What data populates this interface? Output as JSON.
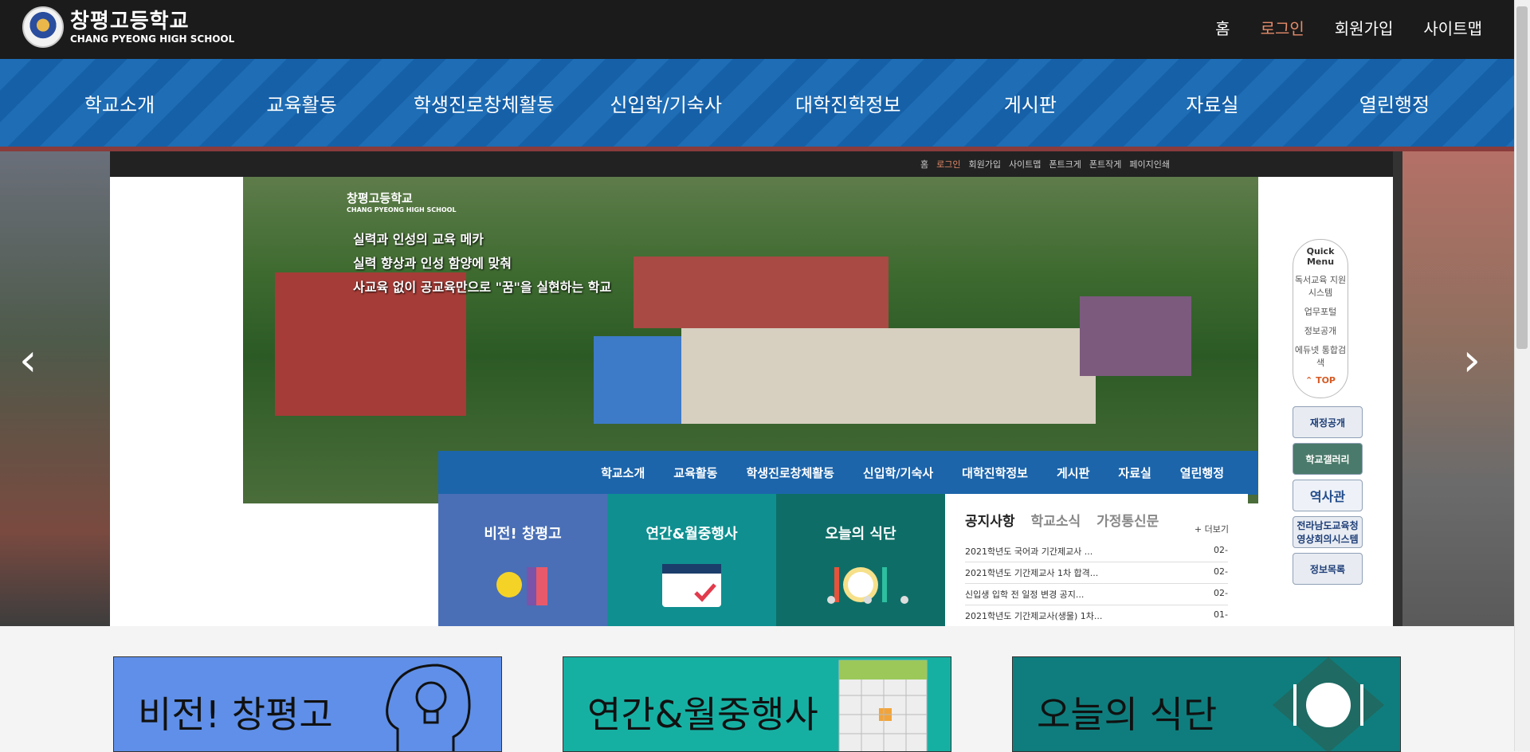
{
  "header": {
    "logo_ko": "창평고등학교",
    "logo_en": "CHANG PYEONG HIGH SCHOOL",
    "util_nav": [
      "홈",
      "로그인",
      "회원가입",
      "사이트맵"
    ]
  },
  "gnb": [
    "학교소개",
    "교육활동",
    "학생진로창체활동",
    "신입학/기숙사",
    "대학진학정보",
    "게시판",
    "자료실",
    "열린행정"
  ],
  "slide": {
    "top_links": [
      "홈",
      "로그인",
      "회원가입",
      "사이트맵",
      "폰트크게",
      "폰트작게",
      "페이지인쇄"
    ],
    "logo_ko": "창평고등학교",
    "logo_en": "CHANG PYEONG HIGH SCHOOL",
    "slogan_1": "실력과 인성의 교육 메카",
    "slogan_2": "실력 향상과 인성 함양에 맞춰",
    "slogan_3": "사교육 없이 공교육만으로 \"꿈\"을 실현하는 학교",
    "inner_nav": [
      "학교소개",
      "교육활동",
      "학생진로창체활동",
      "신입학/기숙사",
      "대학진학정보",
      "게시판",
      "자료실",
      "열린행정"
    ],
    "cards": [
      "비전! 창평고",
      "연간&월중행사",
      "오늘의 식단"
    ],
    "notice": {
      "tabs": [
        "공지사항",
        "학교소식",
        "가정통신문"
      ],
      "more": "+ 더보기",
      "items": [
        {
          "title": "2021학년도 국어과 기간제교사 ...",
          "date": "02-"
        },
        {
          "title": "2021학년도 기간제교사 1차 합격...",
          "date": "02-"
        },
        {
          "title": "신입생 입학 전 일정 변경 공지...",
          "date": "02-"
        },
        {
          "title": "2021학년도 기간제교사(생물) 1차...",
          "date": "01-"
        }
      ]
    },
    "quick_menu": {
      "title": "Quick Menu",
      "items": [
        "독서교육 지원시스템",
        "업무포털",
        "정보공개",
        "에듀넷 통합검색"
      ],
      "top": "TOP"
    },
    "banners": [
      "재정공개",
      "학교갤러리",
      "역사관",
      "전라남도교육청 영상회의시스템",
      "정보목록"
    ]
  },
  "bottom_cards": [
    "비전! 창평고",
    "연간&월중행사",
    "오늘의 식단"
  ]
}
